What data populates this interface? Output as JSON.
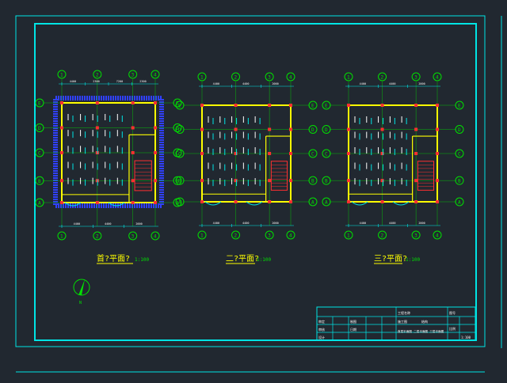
{
  "drawing": {
    "plans": [
      {
        "title": "首?平面?",
        "scale": "1:100",
        "axes_top": [
          "1",
          "2",
          "3",
          "4"
        ],
        "axes_side": [
          "E",
          "D",
          "C",
          "B",
          "A"
        ],
        "dim_top": [
          "4400",
          "2300",
          "7200",
          "2300"
        ],
        "dim_bottom": [
          "4400",
          "4400",
          "2000"
        ]
      },
      {
        "title": "二?平面?",
        "scale": "1:100",
        "axes_top": [
          "1",
          "2",
          "3",
          "4"
        ],
        "axes_side": [
          "E",
          "D",
          "C",
          "B",
          "A"
        ],
        "dim_top": [
          "4400",
          "4400",
          "2000"
        ],
        "dim_bottom": [
          "4400",
          "4400",
          "2000"
        ]
      },
      {
        "title": "三?平面?",
        "scale": "1:100",
        "axes_top": [
          "1",
          "2",
          "3",
          "4"
        ],
        "axes_side": [
          "E",
          "D",
          "C",
          "B",
          "A"
        ],
        "dim_top": [
          "4400",
          "4400",
          "2000"
        ],
        "dim_bottom": [
          "4400",
          "4400",
          "2000"
        ]
      }
    ],
    "title_block": {
      "cells": [
        "工程名称",
        "结构",
        "图号",
        "比例",
        "审定",
        "审核",
        "设计",
        "制图",
        "日期",
        "1:100",
        "施工图",
        "首层平面图 二层平面图 三层平面图"
      ]
    },
    "north_label": "N",
    "colors": {
      "background": "#212830",
      "frame": "#00e5e5",
      "wall": "#ffff00",
      "column": "#ff3030",
      "fixture": "#ffffff",
      "hatch": "#3040ff",
      "axis": "#00e000",
      "dimension": "#00e5e5",
      "title": "#ffff00",
      "scale_text": "#00e000"
    }
  }
}
